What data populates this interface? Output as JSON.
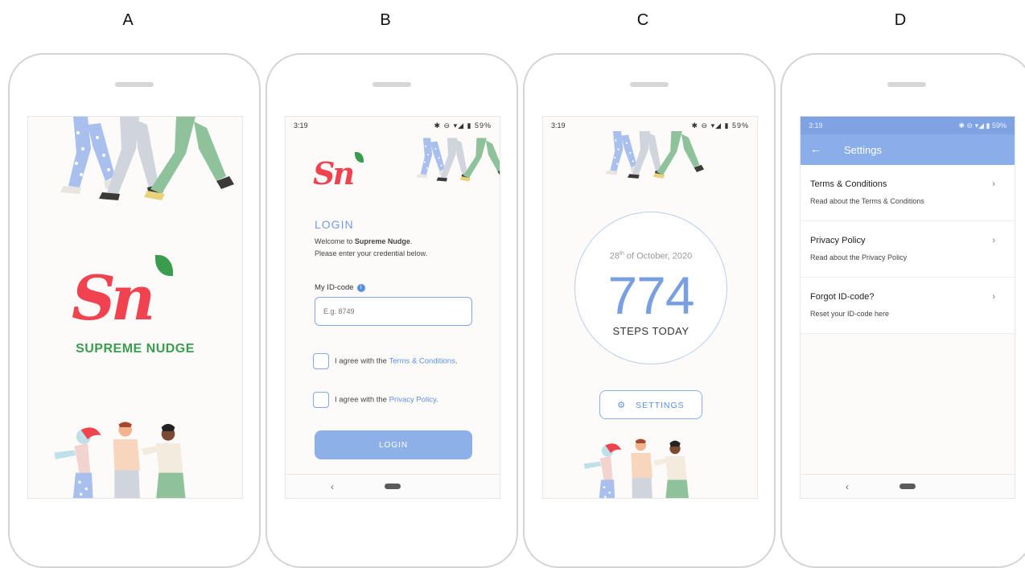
{
  "panels": {
    "a": {
      "letter": "A"
    },
    "b": {
      "letter": "B"
    },
    "c": {
      "letter": "C"
    },
    "d": {
      "letter": "D"
    }
  },
  "status": {
    "time": "3:19",
    "icons": "✱ ⊖ ▾◢ ▮ 59%"
  },
  "splash": {
    "logo_text": "Sn",
    "brand_name": "SUPREME NUDGE"
  },
  "login": {
    "logo_text": "Sn",
    "title": "LOGIN",
    "welcome_prefix": "Welcome to ",
    "welcome_bold": "Supreme Nudge",
    "welcome_suffix": ".",
    "instruction": "Please enter your credential below.",
    "id_label": "My ID-code",
    "id_info_icon": "i",
    "id_placeholder": "E.g. 8749",
    "terms_prefix": "I agree with the ",
    "terms_link": "Terms & Conditions",
    "terms_suffix": ".",
    "privacy_prefix": "I agree with the ",
    "privacy_link": "Privacy Policy",
    "privacy_suffix": ".",
    "button": "LOGIN"
  },
  "steps": {
    "date_day": "28",
    "date_sup": "th",
    "date_rest": " of October, 2020",
    "count": "774",
    "label": "STEPS TODAY",
    "settings_button": "SETTINGS",
    "settings_icon": "gear-icon"
  },
  "settings": {
    "title": "Settings",
    "back_icon": "←",
    "items": [
      {
        "title": "Terms & Conditions",
        "desc": "Read about the Terms & Conditions"
      },
      {
        "title": "Privacy Policy",
        "desc": "Read about the Privacy Policy"
      },
      {
        "title": "Forgot ID-code?",
        "desc": "Reset your ID-code here"
      }
    ]
  },
  "nav": {
    "back": "‹"
  },
  "colors": {
    "brand_red": "#f0434f",
    "leaf_green": "#3a9d4d",
    "accent_blue": "#7ea2e2"
  }
}
